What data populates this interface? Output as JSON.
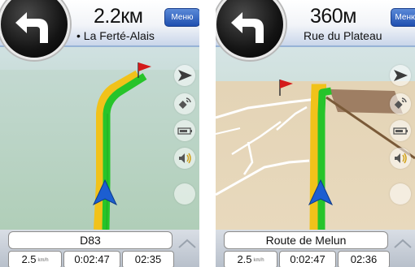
{
  "screens": [
    {
      "distance": "2.2км",
      "next_street": "• La Ferté-Alais",
      "menu_label": "Меню",
      "road_name": "D83",
      "speed": "2.5",
      "speed_unit": "km/h",
      "time_remaining": "0:02:47",
      "eta": "02:35"
    },
    {
      "distance": "360м",
      "next_street": "Rue du Plateau",
      "menu_label": "Меню",
      "road_name": "Route de Melun",
      "speed": "2.5",
      "speed_unit": "km/h",
      "time_remaining": "0:02:47",
      "eta": "02:36"
    }
  ],
  "colors": {
    "route": "#27c42a",
    "menu_button": "#2a5cc0",
    "position_arrow": "#1c5ed1",
    "destination_flag": "#d41a1a"
  },
  "icons": {
    "turn": "turn-left-icon",
    "compass": "direction-arrow-icon",
    "gps": "satellite-icon",
    "battery": "battery-icon",
    "sound": "speaker-icon",
    "destination": "flag-icon",
    "position": "position-arrow-icon",
    "expand": "chevron-up-icon"
  }
}
